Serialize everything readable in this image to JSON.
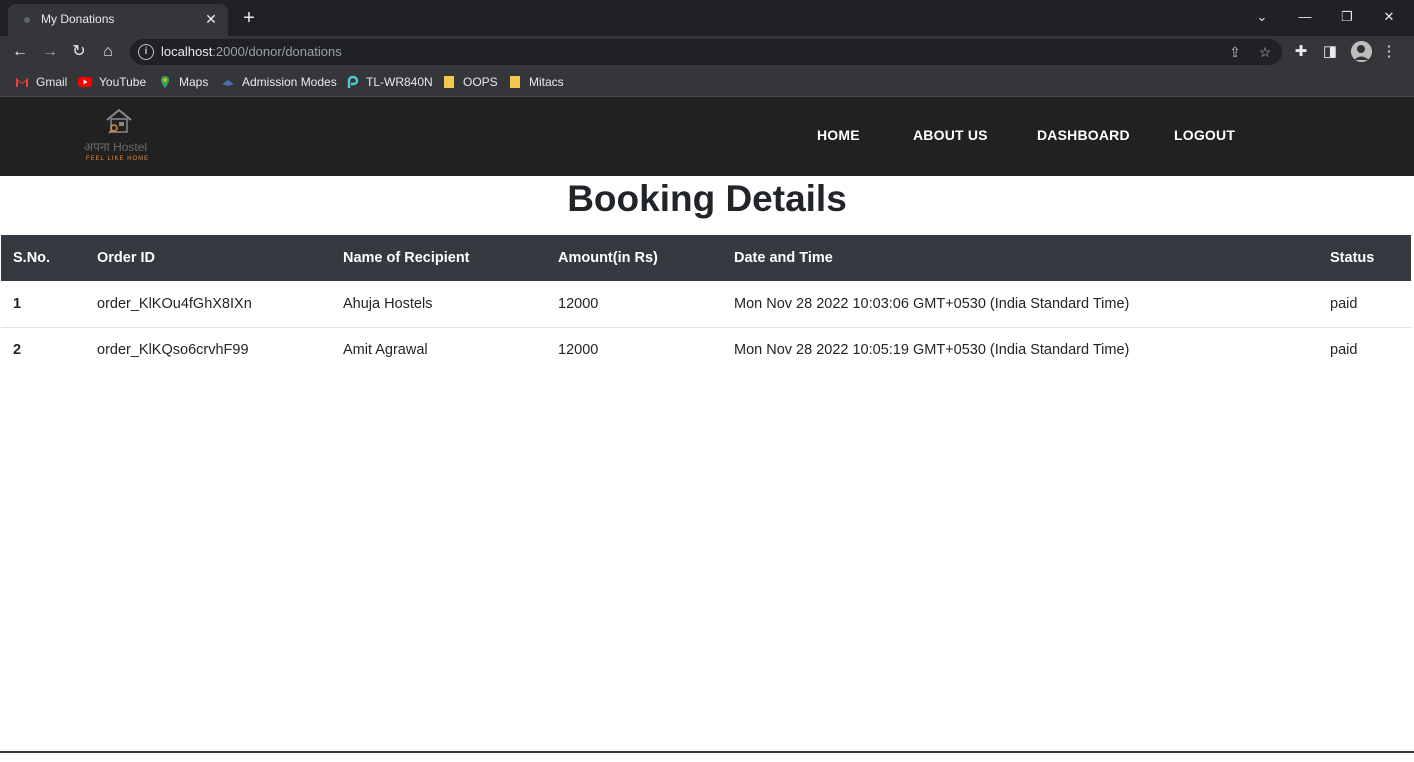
{
  "browser": {
    "tab_title": "My Donations",
    "url_host": "localhost",
    "url_rest": ":2000/donor/donations",
    "bookmarks": [
      {
        "label": "Gmail",
        "icon": "gmail-icon",
        "color": "#ea4335"
      },
      {
        "label": "YouTube",
        "icon": "youtube-icon",
        "color": "#ff0000"
      },
      {
        "label": "Maps",
        "icon": "maps-icon",
        "color": "#34a853"
      },
      {
        "label": "Admission Modes",
        "icon": "admission-icon",
        "color": "#4a6fa5"
      },
      {
        "label": "TL-WR840N",
        "icon": "router-icon",
        "color": "#4acbd6"
      },
      {
        "label": "OOPS",
        "icon": "folder-icon",
        "color": "#f2c94c"
      },
      {
        "label": "Mitacs",
        "icon": "folder-icon",
        "color": "#f2c94c"
      }
    ]
  },
  "site": {
    "logo_text": "अपना Hostel",
    "logo_tag": "FEEL LIKE HOME",
    "nav": [
      "HOME",
      "ABOUT US",
      "DASHBOARD",
      "LOGOUT"
    ]
  },
  "page": {
    "heading": "Booking Details",
    "columns": [
      "S.No.",
      "Order ID",
      "Name of Recipient",
      "Amount(in Rs)",
      "Date and Time",
      "Status"
    ],
    "rows": [
      [
        "1",
        "order_KlKOu4fGhX8IXn",
        "Ahuja Hostels",
        "12000",
        "Mon Nov 28 2022 10:03:06 GMT+0530 (India Standard Time)",
        "paid"
      ],
      [
        "2",
        "order_KlKQso6crvhF99",
        "Amit Agrawal",
        "12000",
        "Mon Nov 28 2022 10:05:19 GMT+0530 (India Standard Time)",
        "paid"
      ]
    ]
  },
  "colors": {
    "site_nav_bg": "#212121",
    "table_header_bg": "#343a40",
    "accent_orange": "#e08a3c"
  }
}
